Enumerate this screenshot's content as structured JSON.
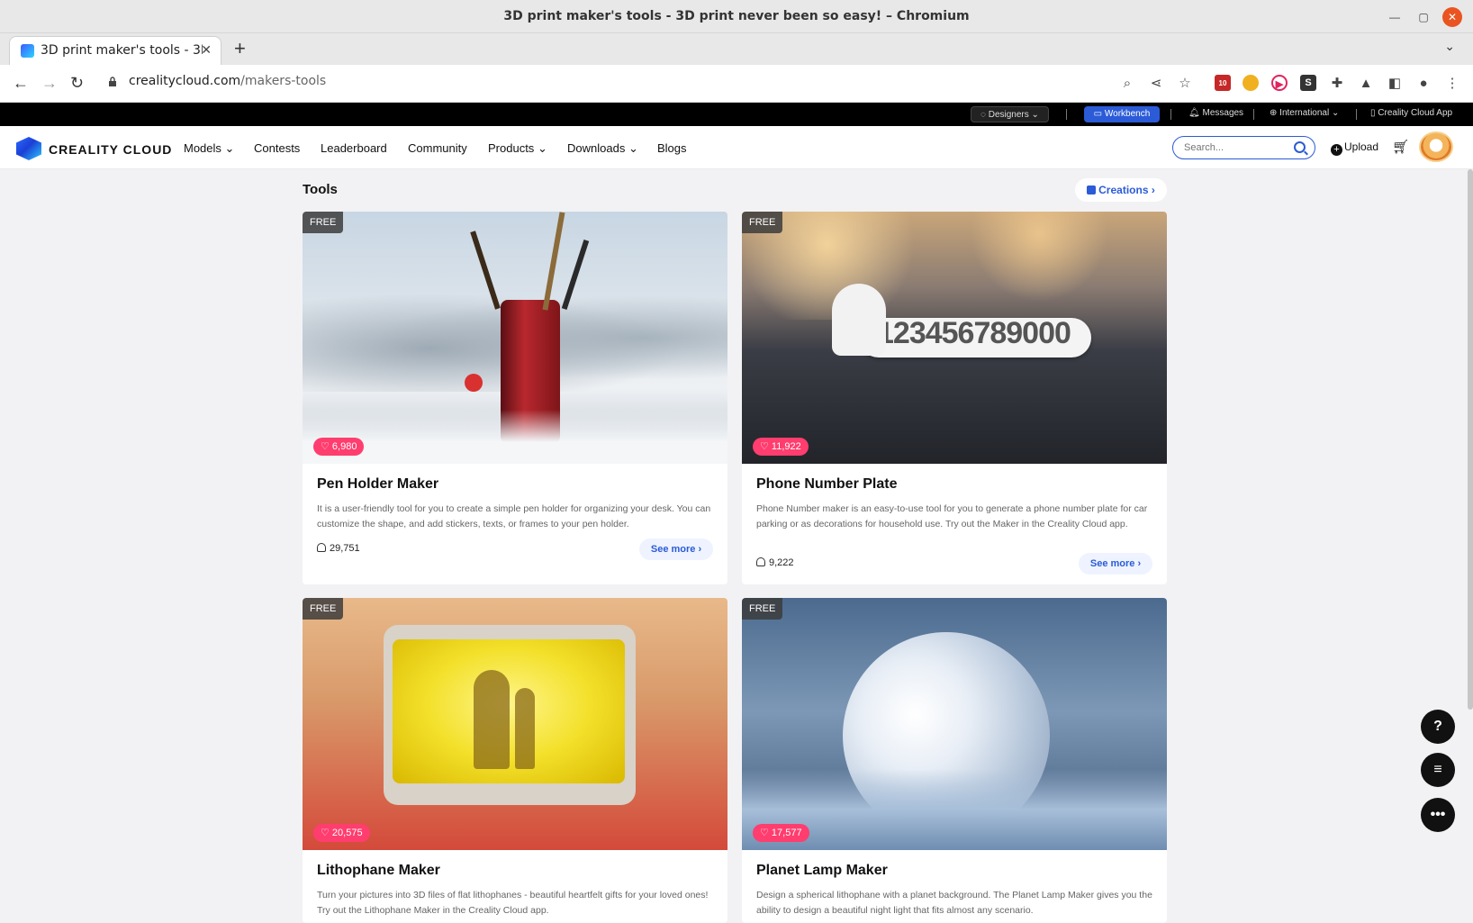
{
  "window": {
    "title": "3D print maker's tools - 3D print never been so easy! – Chromium"
  },
  "tab": {
    "title": "3D print maker's tools - 3D"
  },
  "address": {
    "domain": "crealitycloud.com",
    "path": "/makers-tools"
  },
  "extensions": {
    "badge_count": "10"
  },
  "topbar": {
    "designers": "Designers",
    "workbench": "Workbench",
    "messages": "Messages",
    "international": "International",
    "app": "Creality Cloud App"
  },
  "nav": {
    "logo": "CREALITY CLOUD",
    "items": [
      "Models",
      "Contests",
      "Leaderboard",
      "Community",
      "Products",
      "Downloads",
      "Blogs"
    ],
    "search_placeholder": "Search...",
    "upload": "Upload"
  },
  "section": {
    "title": "Tools",
    "creations": "Creations"
  },
  "cards": [
    {
      "badge": "FREE",
      "likes": "6,980",
      "title": "Pen Holder Maker",
      "desc": "It is a user-friendly tool for you to create a simple pen holder for organizing your desk. You can customize the shape, and add stickers, texts, or frames to your pen holder.",
      "users": "29,751",
      "see_more": "See more"
    },
    {
      "badge": "FREE",
      "likes": "11,922",
      "title": "Phone Number Plate",
      "desc": "Phone Number maker is an easy-to-use tool for you to generate a phone number plate for car parking or as decorations for household use. Try out the Maker in the Creality Cloud app.",
      "users": "9,222",
      "see_more": "See more",
      "plate_text": "123456789000"
    },
    {
      "badge": "FREE",
      "likes": "20,575",
      "title": "Lithophane Maker",
      "desc": "Turn your pictures into 3D files of flat lithophanes - beautiful heartfelt gifts for your loved ones! Try out the Lithophane Maker in the Creality Cloud app."
    },
    {
      "badge": "FREE",
      "likes": "17,577",
      "title": "Planet Lamp Maker",
      "desc": "Design a spherical lithophane with a planet background. The Planet Lamp Maker gives you the ability to design a beautiful night light that fits almost any scenario."
    }
  ]
}
